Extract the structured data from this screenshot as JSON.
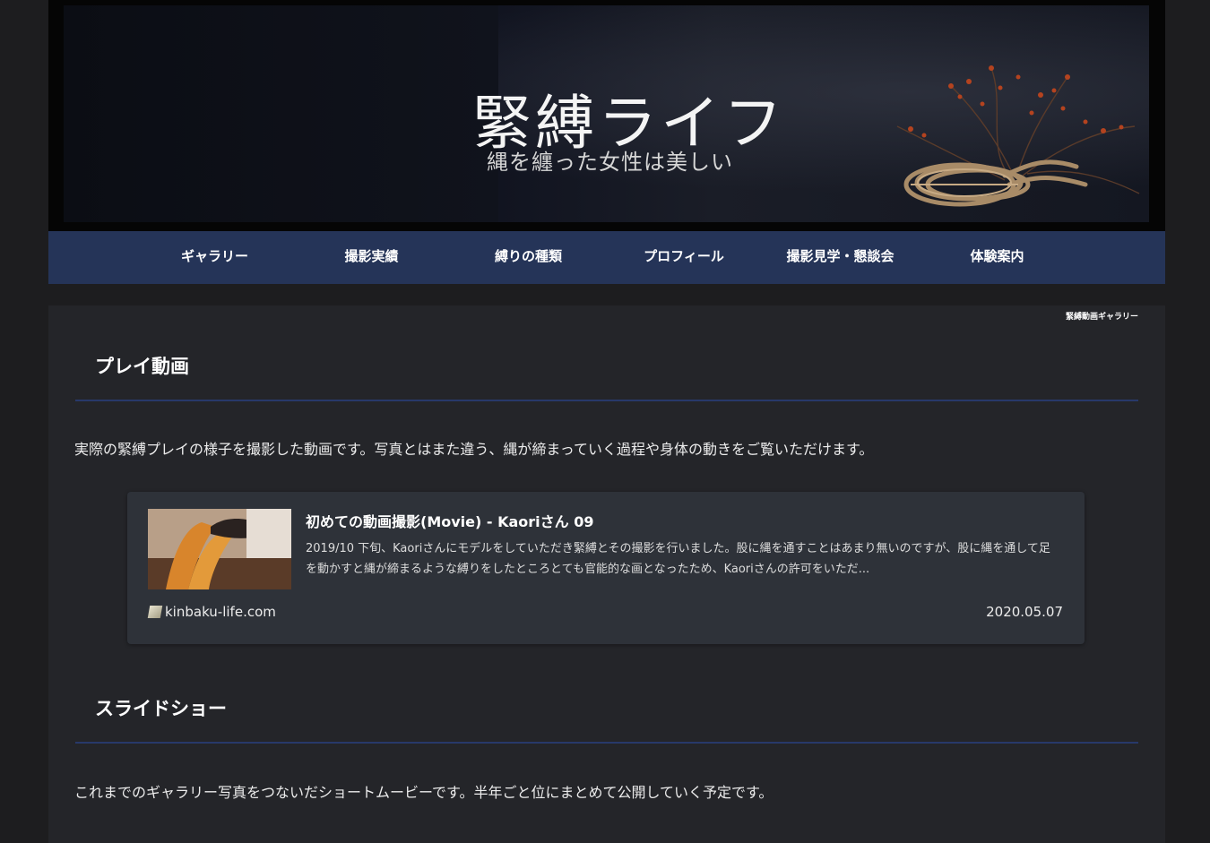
{
  "header": {
    "logo_title": "緊縛ライフ",
    "logo_tagline": "縄を纏った女性は美しい"
  },
  "nav": {
    "items": [
      {
        "label": "ギャラリー"
      },
      {
        "label": "撮影実績"
      },
      {
        "label": "縛りの種類"
      },
      {
        "label": "プロフィール"
      },
      {
        "label": "撮影見学・懇談会"
      },
      {
        "label": "体験案内"
      }
    ],
    "background": "#253458"
  },
  "breadcrumb": "緊縛動画ギャラリー",
  "sections": [
    {
      "heading": "プレイ動画",
      "text": "実際の緊縛プレイの様子を撮影した動画です。写真とはまた違う、縄が締まっていく過程や身体の動きをご覧いただけます。"
    },
    {
      "heading": "スライドショー",
      "text": "これまでのギャラリー写真をつないだショートムービーです。半年ごと位にまとめて公開していく予定です。"
    }
  ],
  "card": {
    "title": "初めての動画撮影(Movie) - Kaoriさん 09",
    "excerpt": "2019/10 下旬、Kaoriさんにモデルをしていただき緊縛とその撮影を行いました。股に縄を通すことはあまり無いのですが、股に縄を通して足を動かすと縄が締まるような縛りをしたところとても官能的な画となったため、Kaoriさんの許可をいただ...",
    "site": "kinbaku-life.com",
    "date": "2020.05.07",
    "favicon": "site-favicon-icon"
  },
  "colors": {
    "page_bg": "#1d1d1f",
    "content_bg": "#242529",
    "card_bg": "#2e3239",
    "accent_rule": "#28396a"
  }
}
